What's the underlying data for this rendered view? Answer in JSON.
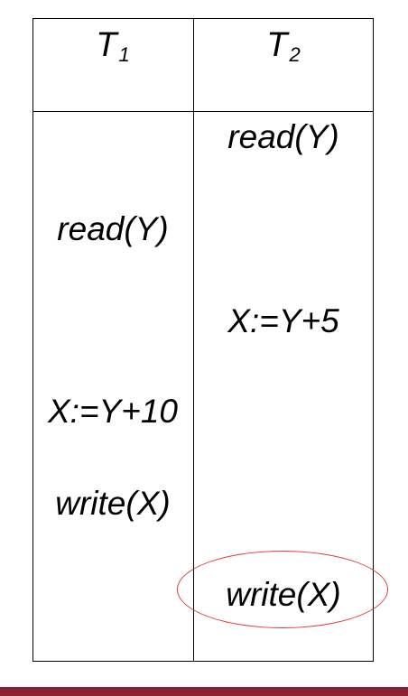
{
  "columns": [
    {
      "label": "T",
      "sub": "1"
    },
    {
      "label": "T",
      "sub": "2"
    }
  ],
  "steps": [
    {
      "t2": "read(Y)"
    },
    {
      "t1": "read(Y)"
    },
    {
      "t2": "X:=Y+5"
    },
    {
      "t1": "X:=Y+10"
    },
    {
      "t1": "write(X)"
    },
    {
      "t2": "write(X)"
    }
  ],
  "highlight_color": "#e23a3a",
  "footer_color": "#8a2032"
}
